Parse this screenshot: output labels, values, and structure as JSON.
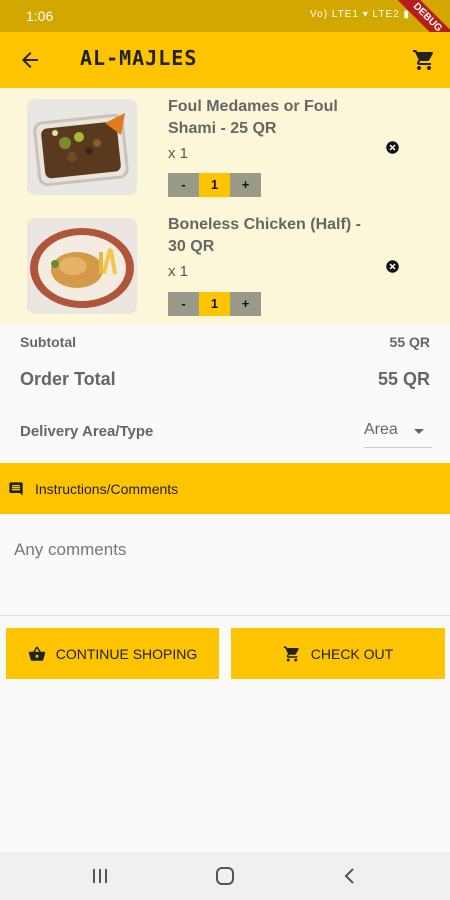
{
  "status": {
    "time": "1:06",
    "icons_text": "Vo) LTE1 ▾ LTE2 ▮",
    "debug_label": "DEBUG"
  },
  "app_bar": {
    "title": "AL-MAJLES"
  },
  "cart": {
    "items": [
      {
        "name": "Foul Medames or Foul Shami - 25 QR",
        "quantity_text": "x 1",
        "quantity": "1",
        "minus": "-",
        "plus": "+"
      },
      {
        "name": "Boneless Chicken (Half) - 30 QR",
        "quantity_text": "x 1",
        "quantity": "1",
        "minus": "-",
        "plus": "+"
      }
    ]
  },
  "summary": {
    "subtotal_label": "Subtotal",
    "subtotal_value": "55 QR",
    "total_label": "Order Total",
    "total_value": "55 QR",
    "delivery_label": "Delivery Area/Type",
    "delivery_value": "Area"
  },
  "instructions": {
    "label": "Instructions/Comments",
    "placeholder": "Any comments"
  },
  "actions": {
    "continue_label": "CONTINUE SHOPING",
    "checkout_label": "CHECK OUT"
  },
  "colors": {
    "accent": "#ffc400",
    "status_bar": "#d1a700",
    "list_bg": "#fdf7da"
  }
}
